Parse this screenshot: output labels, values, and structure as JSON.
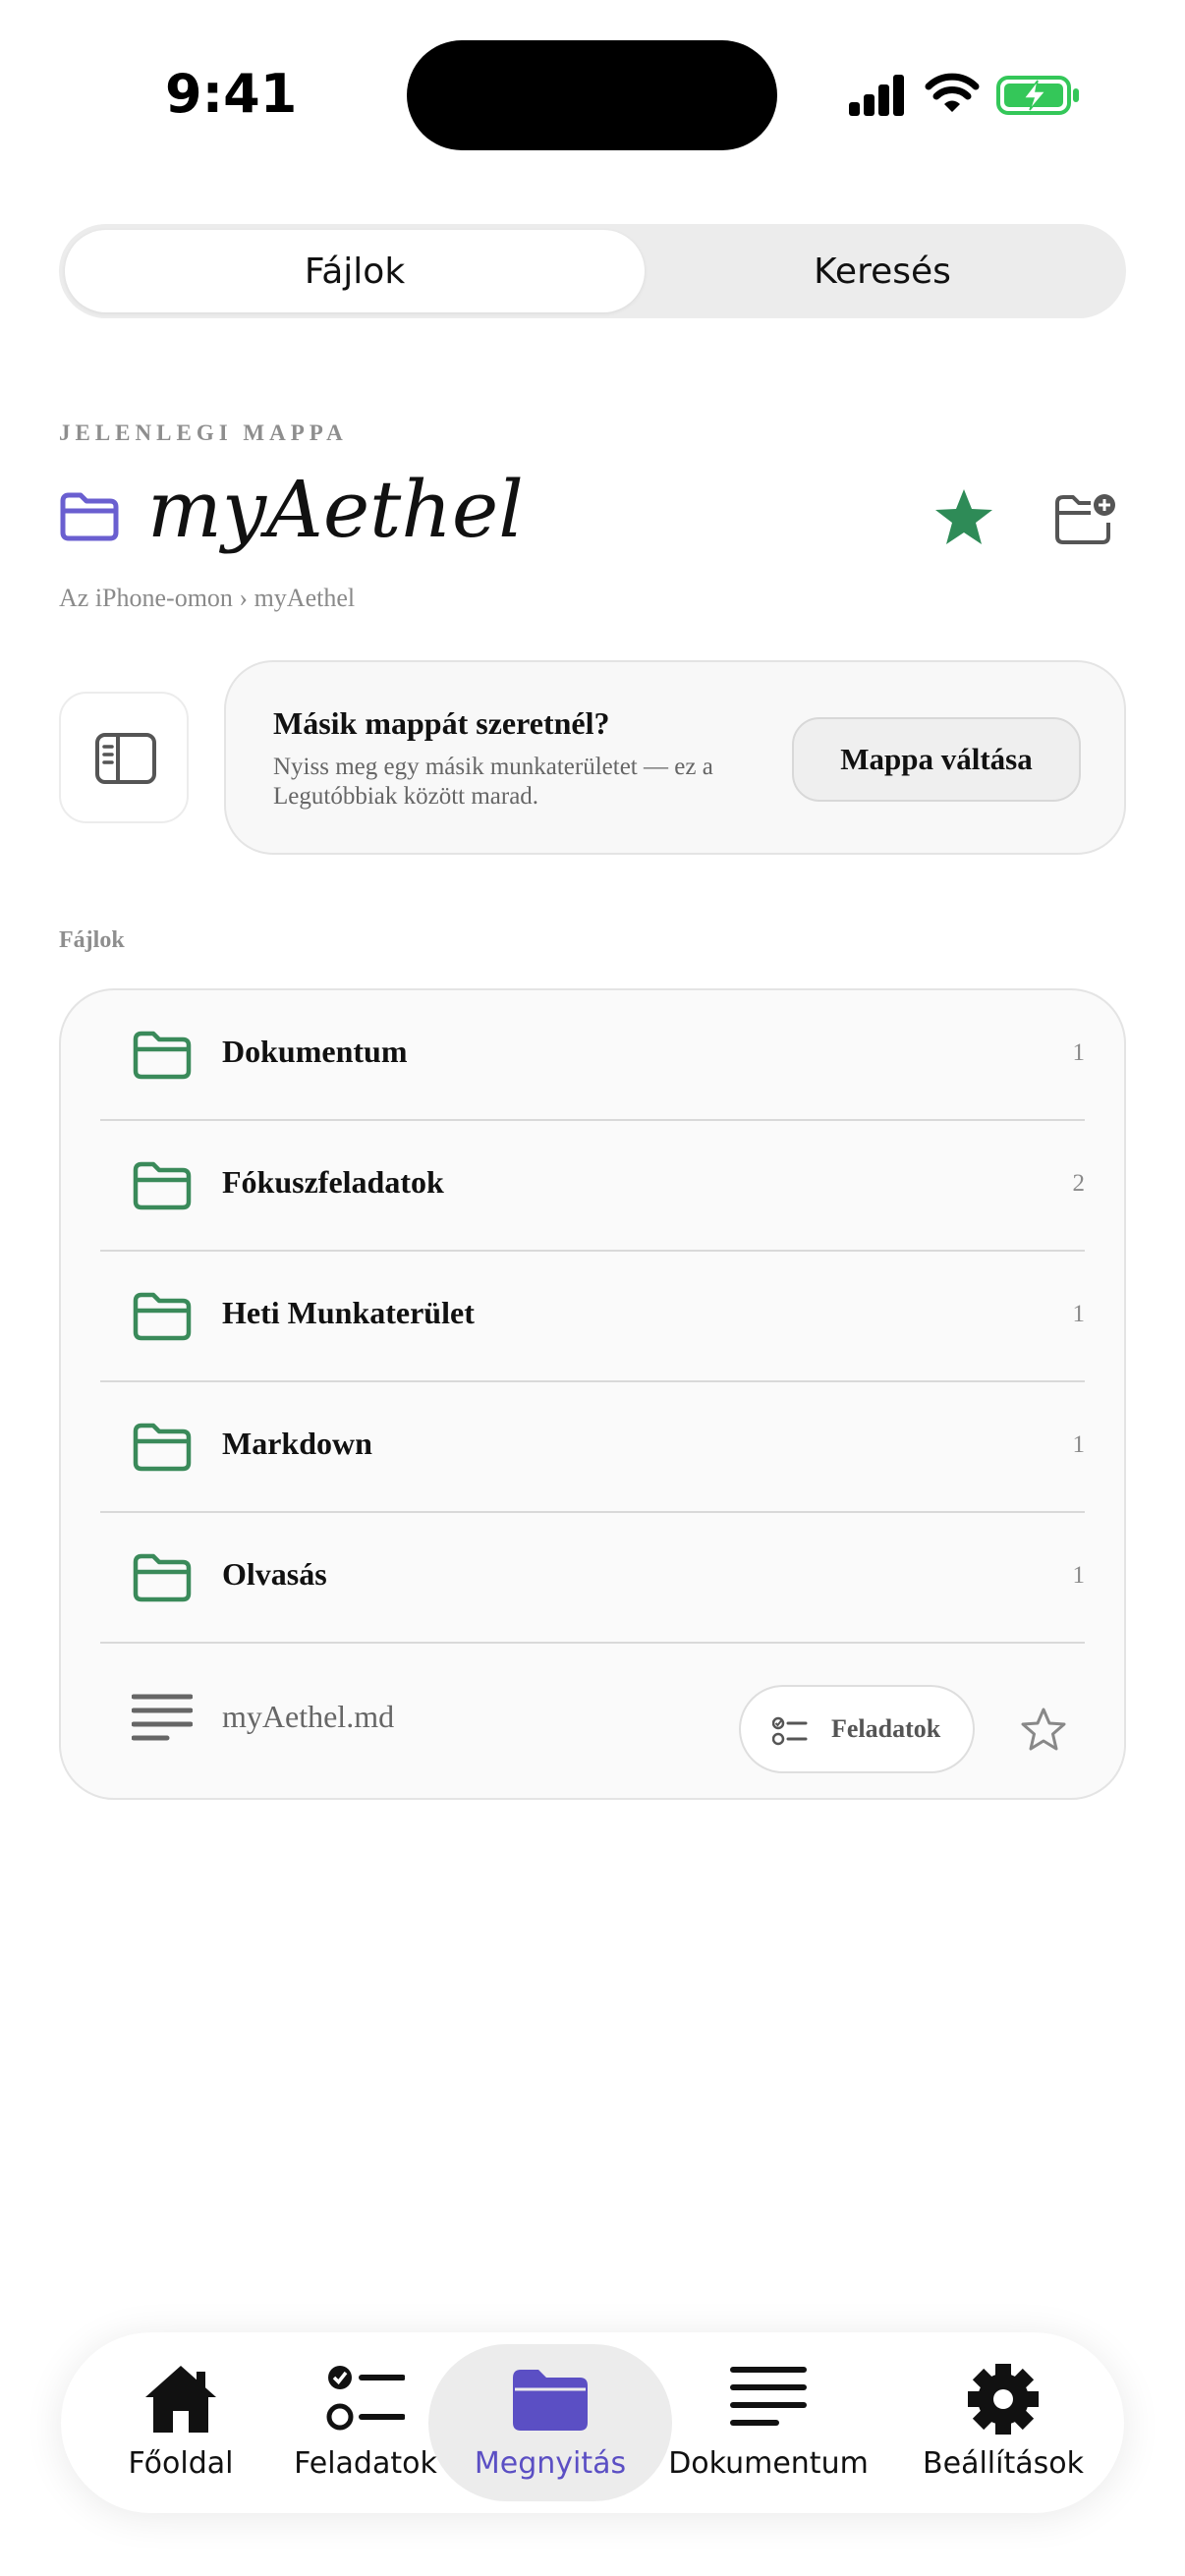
{
  "status_bar": {
    "time": "9:41"
  },
  "segmented": {
    "files_label": "Fájlok",
    "search_label": "Keresés"
  },
  "current_folder": {
    "caption": "JELENLEGI MAPPA",
    "title": "myAethel",
    "breadcrumb": "Az iPhone-omon › myAethel"
  },
  "switch_card": {
    "title": "Másik mappát szeretnél?",
    "description": "Nyiss meg egy másik munkaterületet — ez a Legutóbbiak között marad.",
    "button_label": "Mappa váltása"
  },
  "files": {
    "caption": "Fájlok",
    "folders": [
      {
        "name": "Dokumentum",
        "count": "1"
      },
      {
        "name": "Fókuszfeladatok",
        "count": "2"
      },
      {
        "name": "Heti Munkaterület",
        "count": "1"
      },
      {
        "name": "Markdown",
        "count": "1"
      },
      {
        "name": "Olvasás",
        "count": "1"
      }
    ],
    "document": {
      "name": "myAethel.md",
      "tasks_chip_label": "Feladatok"
    }
  },
  "tabbar": {
    "items": [
      {
        "label": "Főoldal",
        "icon": "house-icon"
      },
      {
        "label": "Feladatok",
        "icon": "tasks-icon"
      },
      {
        "label": "Megnyitás",
        "icon": "folder-icon"
      },
      {
        "label": "Dokumentum",
        "icon": "document-icon"
      },
      {
        "label": "Beállítások",
        "icon": "gear-icon"
      }
    ],
    "active": "Megnyitás"
  },
  "colors": {
    "accent_purple": "#5b4fc4",
    "folder_green": "#3a8a5a",
    "star_green": "#2e8b57",
    "battery_green": "#34c759"
  }
}
